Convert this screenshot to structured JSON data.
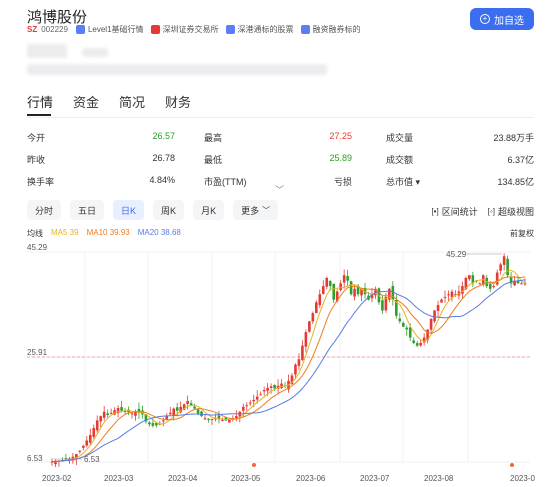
{
  "stock": {
    "name": "鸿博股份",
    "market_badge": "SZ",
    "code": "002229",
    "tags": [
      "Level1基础行情",
      "深圳证券交易所",
      "深港通标的股票",
      "融资融券标的"
    ],
    "add_button": "加自选"
  },
  "tabs": [
    "行情",
    "资金",
    "简况",
    "财务"
  ],
  "stats": [
    [
      {
        "label": "今开",
        "value": "26.57",
        "color": "down"
      },
      {
        "label": "最高",
        "value": "27.25",
        "color": "up"
      },
      {
        "label": "成交量",
        "value": "23.88万手",
        "color": ""
      }
    ],
    [
      {
        "label": "昨收",
        "value": "26.78",
        "color": ""
      },
      {
        "label": "最低",
        "value": "25.89",
        "color": "down"
      },
      {
        "label": "成交额",
        "value": "6.37亿",
        "color": ""
      }
    ],
    [
      {
        "label": "换手率",
        "value": "4.84%",
        "color": ""
      },
      {
        "label": "市盈(TTM)",
        "value": "亏损",
        "color": ""
      },
      {
        "label": "总市值 ▾",
        "value": "134.85亿",
        "color": ""
      }
    ]
  ],
  "periods": [
    "分时",
    "五日",
    "日K",
    "周K",
    "月K",
    "更多"
  ],
  "active_period": "日K",
  "tools": {
    "range_stats": "区间统计",
    "super_view": "超级视图"
  },
  "ma_legend": {
    "label": "均线",
    "ma5": "MA5 39",
    "ma10": "MA10 39.93",
    "ma20": "MA20 38.68"
  },
  "fq_label": "前复权",
  "colors": {
    "up": "#e53935",
    "down": "#2ca02c",
    "accent": "#3a6df0",
    "ma5": "#e6b422",
    "ma10": "#f07c1e",
    "ma20": "#5b7be0"
  },
  "chart_data": {
    "type": "candlestick",
    "y_range": [
      6.53,
      45.29
    ],
    "y_tick_labels": [
      "45.29",
      "25.91",
      "6.53"
    ],
    "reference_line": 25.91,
    "max_label": "45.29",
    "min_label": "6.53",
    "x_tick_labels": [
      "2023-02",
      "2023-03",
      "2023-04",
      "2023-05",
      "2023-06",
      "2023-07",
      "2023-08",
      "2023-0"
    ],
    "closes": [
      6.6,
      6.7,
      6.8,
      6.9,
      7.0,
      7.2,
      7.5,
      8.0,
      8.6,
      9.5,
      10.5,
      11.5,
      12.8,
      14.2,
      15.0,
      15.8,
      15.2,
      15.6,
      16.1,
      16.5,
      16.0,
      15.8,
      15.7,
      15.5,
      15.9,
      15.6,
      15.3,
      14.0,
      13.5,
      13.2,
      13.3,
      13.6,
      14.2,
      15.0,
      15.6,
      16.4,
      16.0,
      16.7,
      17.2,
      17.8,
      17.0,
      16.4,
      15.5,
      15.0,
      14.6,
      14.4,
      14.5,
      14.6,
      14.4,
      14.3,
      14.2,
      14.3,
      14.6,
      15.0,
      15.8,
      16.7,
      17.0,
      17.5,
      18.0,
      18.6,
      19.0,
      19.8,
      20.2,
      20.5,
      20.1,
      20.6,
      21.0,
      20.5,
      21.5,
      22.5,
      24.5,
      25.5,
      28.0,
      30.5,
      32.5,
      34.0,
      36.0,
      37.5,
      39.0,
      40.5,
      39.0,
      36.5,
      38.0,
      39.5,
      41.0,
      40.0,
      37.5,
      38.5,
      37.5,
      38.5,
      37.5,
      36.5,
      37.5,
      38.5,
      36.0,
      34.5,
      37.0,
      38.5,
      36.5,
      33.5,
      32.5,
      31.5,
      31.0,
      29.5,
      28.5,
      28.0,
      28.5,
      29.5,
      31.0,
      33.0,
      34.5,
      35.5,
      36.5,
      37.0,
      37.5,
      38.0,
      37.5,
      38.0,
      39.0,
      40.5,
      41.0,
      39.5,
      40.0,
      39.5,
      41.0,
      39.0,
      38.5,
      39.0,
      41.5,
      43.0,
      44.5,
      41.0,
      39.5,
      40.0,
      39.5,
      39.5,
      39.5
    ]
  }
}
